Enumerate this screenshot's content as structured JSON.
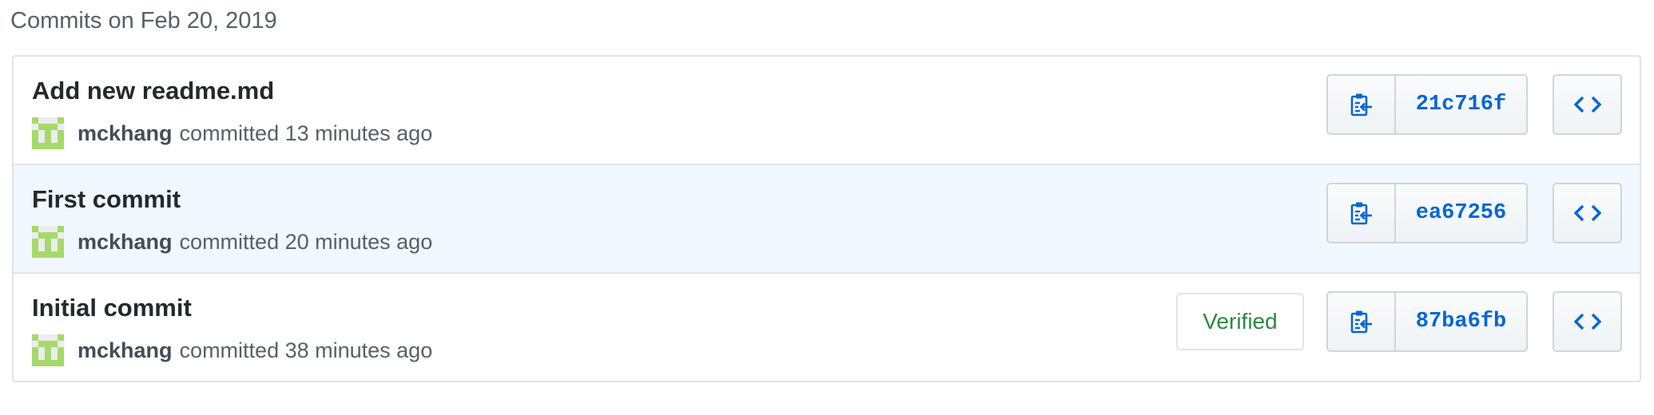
{
  "group_header": "Commits on Feb 20, 2019",
  "commits": [
    {
      "title": "Add new readme.md",
      "author": "mckhang",
      "action": "committed 13 minutes ago",
      "sha": "21c716f",
      "verified": null,
      "highlighted": false
    },
    {
      "title": "First commit",
      "author": "mckhang",
      "action": "committed 20 minutes ago",
      "sha": "ea67256",
      "verified": null,
      "highlighted": true
    },
    {
      "title": "Initial commit",
      "author": "mckhang",
      "action": "committed 38 minutes ago",
      "sha": "87ba6fb",
      "verified": "Verified",
      "highlighted": false
    }
  ],
  "icons": {
    "copy": "clippy-icon",
    "browse": "code-icon",
    "avatar": "identicon-avatar"
  },
  "colors": {
    "link": "#0366d6",
    "verified": "#2c8a3f",
    "highlight_row": "#f1f8ff",
    "avatar": "#a6d96a"
  }
}
